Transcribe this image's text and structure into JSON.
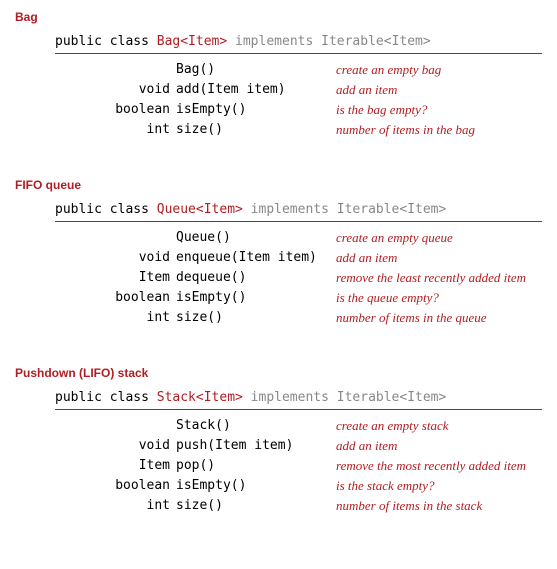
{
  "sections": [
    {
      "title": "Bag",
      "decl": {
        "prefix": "public class ",
        "name": "Bag<Item>",
        "impl": " implements Iterable<Item>"
      },
      "methods": [
        {
          "ret": "",
          "sig": "Bag()",
          "desc": "create an empty bag"
        },
        {
          "ret": "void",
          "sig": "add(Item item)",
          "desc": "add an item"
        },
        {
          "ret": "boolean",
          "sig": "isEmpty()",
          "desc": "is the bag empty?"
        },
        {
          "ret": "int",
          "sig": "size()",
          "desc": "number of items in the bag"
        }
      ]
    },
    {
      "title": "FIFO queue",
      "decl": {
        "prefix": "public class ",
        "name": "Queue<Item>",
        "impl": " implements Iterable<Item>"
      },
      "methods": [
        {
          "ret": "",
          "sig": "Queue()",
          "desc": "create an empty queue"
        },
        {
          "ret": "void",
          "sig": "enqueue(Item item)",
          "desc": "add an item"
        },
        {
          "ret": "Item",
          "sig": "dequeue()",
          "desc": "remove the least recently added item"
        },
        {
          "ret": "boolean",
          "sig": "isEmpty()",
          "desc": "is the queue empty?"
        },
        {
          "ret": "int",
          "sig": "size()",
          "desc": "number of items in the queue"
        }
      ]
    },
    {
      "title": "Pushdown (LIFO) stack",
      "decl": {
        "prefix": "public class ",
        "name": "Stack<Item>",
        "impl": " implements Iterable<Item>"
      },
      "methods": [
        {
          "ret": "",
          "sig": "Stack()",
          "desc": "create an empty stack"
        },
        {
          "ret": "void",
          "sig": "push(Item item)",
          "desc": "add an item"
        },
        {
          "ret": "Item",
          "sig": "pop()",
          "desc": "remove the most recently added item"
        },
        {
          "ret": "boolean",
          "sig": "isEmpty()",
          "desc": "is the stack empty?"
        },
        {
          "ret": "int",
          "sig": "size()",
          "desc": "number of items in the stack"
        }
      ]
    }
  ]
}
